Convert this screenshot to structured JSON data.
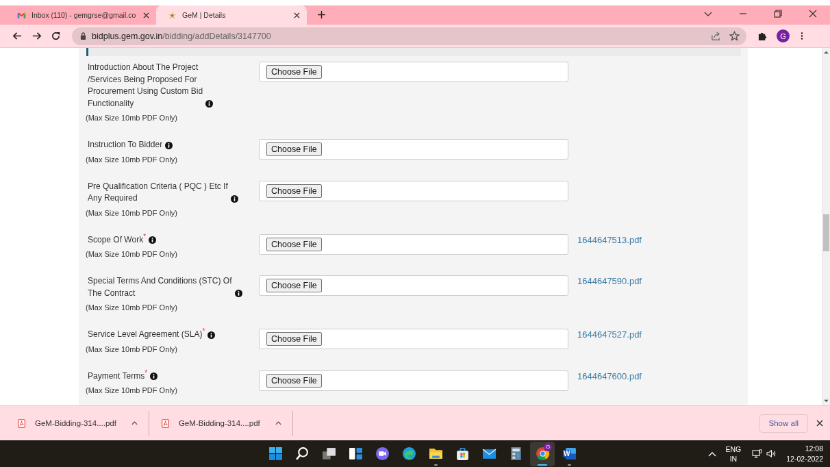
{
  "tabs": [
    {
      "kind": "gmail",
      "title": "Inbox (110) - gemgrse@gmail.co",
      "selected": false
    },
    {
      "kind": "gem",
      "title": "GeM | Details",
      "selected": true
    }
  ],
  "address": {
    "host": "bidplus.gem.gov.in",
    "path": "/bidding/addDetails/3147700"
  },
  "profile": "G",
  "required_mark": "*",
  "fields": [
    {
      "label": [
        "Introduction About The Project",
        "/Services Being Proposed For",
        "Procurement Using Custom Bid",
        "Functionality"
      ],
      "required": false,
      "button": "Choose File",
      "note": "(Max Size 10mb PDF Only)"
    },
    {
      "label": [
        "Instruction To Bidder"
      ],
      "required": false,
      "button": "Choose File",
      "note": "(Max Size 10mb PDF Only)"
    },
    {
      "label": [
        "Pre Qualification Criteria ( PQC ) Etc If",
        "Any Required"
      ],
      "required": false,
      "button": "Choose File",
      "note": "(Max Size 10mb PDF Only)"
    },
    {
      "label": [
        "Scope Of Work"
      ],
      "required": true,
      "button": "Choose File",
      "note": "(Max Size 10mb PDF Only)",
      "file": "1644647513.pdf"
    },
    {
      "label": [
        "Special Terms And Conditions (STC) Of",
        "The Contract"
      ],
      "required": false,
      "button": "Choose File",
      "note": "(Max Size 10mb PDF Only)",
      "file": "1644647590.pdf"
    },
    {
      "label": [
        "Service Level Agreement (SLA)"
      ],
      "required": true,
      "button": "Choose File",
      "note": "(Max Size 10mb PDF Only)",
      "file": "1644647527.pdf"
    },
    {
      "label": [
        "Payment Terms"
      ],
      "required": true,
      "button": "Choose File",
      "note": "(Max Size 10mb PDF Only)",
      "file": "1644647600.pdf"
    }
  ],
  "downloads": [
    {
      "name": "GeM-Bidding-314....pdf"
    },
    {
      "name": "GeM-Bidding-314....pdf"
    }
  ],
  "show_all": "Show all",
  "taskbar": [
    {
      "kind": "start",
      "running": false,
      "active": false
    },
    {
      "kind": "search",
      "running": false,
      "active": false
    },
    {
      "kind": "taskview",
      "running": false,
      "active": false
    },
    {
      "kind": "widgets",
      "running": false,
      "active": false
    },
    {
      "kind": "chat",
      "running": false,
      "active": false
    },
    {
      "kind": "edge",
      "running": false,
      "active": false
    },
    {
      "kind": "explorer",
      "running": true,
      "active": false
    },
    {
      "kind": "store",
      "running": false,
      "active": false
    },
    {
      "kind": "mail",
      "running": false,
      "active": false
    },
    {
      "kind": "calculator",
      "running": false,
      "active": false
    },
    {
      "kind": "chrome",
      "running": true,
      "active": true,
      "badge": "G"
    },
    {
      "kind": "word",
      "running": true,
      "active": false,
      "letter": "W"
    }
  ],
  "tray": {
    "lang": "ENG",
    "region": "IN",
    "time": "12:08",
    "date": "12-02-2022"
  }
}
